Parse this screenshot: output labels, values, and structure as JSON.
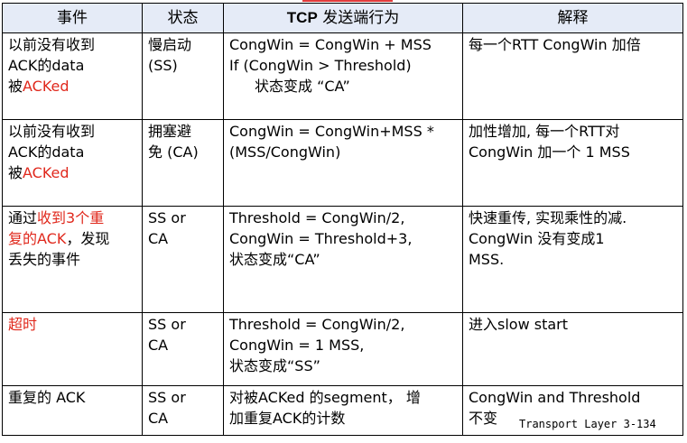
{
  "table": {
    "headers": [
      {
        "pre": "事件",
        "bold": "",
        "post": ""
      },
      {
        "pre": "状态",
        "bold": "",
        "post": ""
      },
      {
        "pre": "",
        "bold": "TCP",
        "post": " 发送端行为"
      },
      {
        "pre": "解释",
        "bold": "",
        "post": ""
      }
    ],
    "rows": [
      {
        "event": [
          [
            {
              "t": "以前没有收到",
              "red": false
            }
          ],
          [
            {
              "t": "ACK的data",
              "red": false
            }
          ],
          [
            {
              "t": "被",
              "red": false
            },
            {
              "t": "ACKed",
              "red": true
            }
          ]
        ],
        "state": [
          "慢启动",
          "(SS)"
        ],
        "action": [
          "CongWin = CongWin + MSS",
          "If (CongWin > Threshold)",
          "状态变成 “CA”"
        ],
        "action_indent": [
          false,
          false,
          true
        ],
        "explain": [
          "每一个RTT CongWin 加倍"
        ]
      },
      {
        "event": [
          [
            {
              "t": "以前没有收到",
              "red": false
            }
          ],
          [
            {
              "t": "ACK的data",
              "red": false
            }
          ],
          [
            {
              "t": "被",
              "red": false
            },
            {
              "t": "ACKed",
              "red": true
            }
          ]
        ],
        "state": [
          "拥塞避",
          "免 (CA)"
        ],
        "action": [
          "CongWin = CongWin+MSS *",
          "(MSS/CongWin)"
        ],
        "action_indent": [
          false,
          false
        ],
        "explain": [
          "加性增加, 每一个RTT对",
          "CongWin 加一个 1 MSS"
        ]
      },
      {
        "event": [
          [
            {
              "t": "通过",
              "red": false
            },
            {
              "t": "收到3个重",
              "red": true
            }
          ],
          [
            {
              "t": "复的ACK",
              "red": true
            },
            {
              "t": "，发现",
              "red": false
            }
          ],
          [
            {
              "t": "丢失的事件",
              "red": false
            }
          ]
        ],
        "state": [
          "SS or",
          "CA"
        ],
        "action": [
          "Threshold = CongWin/2,",
          "CongWin = Threshold+3,",
          "状态变成“CA”"
        ],
        "action_indent": [
          false,
          false,
          false
        ],
        "explain": [
          "快速重传, 实现乘性的减.",
          "CongWin 没有变成1",
          "MSS."
        ]
      },
      {
        "event": [
          [
            {
              "t": "超时",
              "red": true
            }
          ]
        ],
        "state": [
          "SS or",
          "CA"
        ],
        "action": [
          "Threshold = CongWin/2,",
          "CongWin = 1 MSS,",
          "状态变成“SS”"
        ],
        "action_indent": [
          false,
          false,
          false
        ],
        "explain": [
          "进入slow start"
        ]
      },
      {
        "event": [
          [
            {
              "t": "重复的 ACK",
              "red": false
            }
          ]
        ],
        "state": [
          "SS or",
          "CA"
        ],
        "action": [
          "对被ACKed 的segment， 增",
          "加重复ACK的计数"
        ],
        "action_indent": [
          false,
          false
        ],
        "explain": [
          "CongWin and Threshold",
          "不变"
        ]
      }
    ]
  },
  "footer": "Transport Layer 3-134"
}
